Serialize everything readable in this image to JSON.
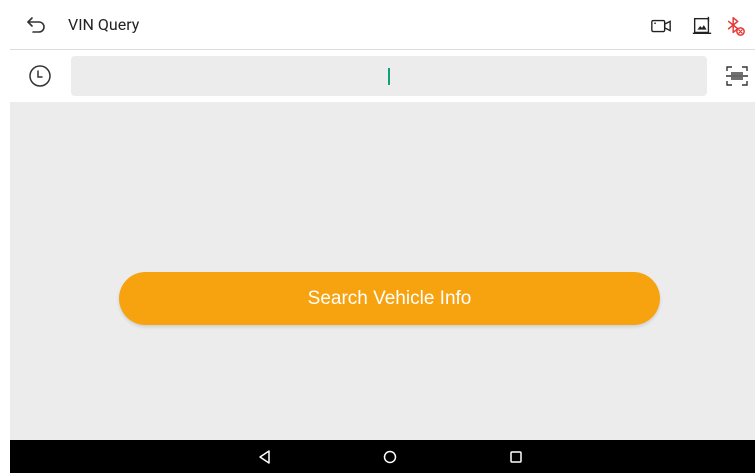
{
  "header": {
    "title": "VIN Query",
    "icons": [
      "back-arrow-icon",
      "video-camera-icon",
      "image-icon",
      "bluetooth-disabled-icon"
    ]
  },
  "search": {
    "value": "",
    "placeholder": ""
  },
  "main": {
    "search_button_label": "Search Vehicle Info"
  },
  "colors": {
    "accent": "#f7a30f",
    "bluetooth_off": "#e53935",
    "caret": "#11a07a",
    "background": "#ececec"
  }
}
